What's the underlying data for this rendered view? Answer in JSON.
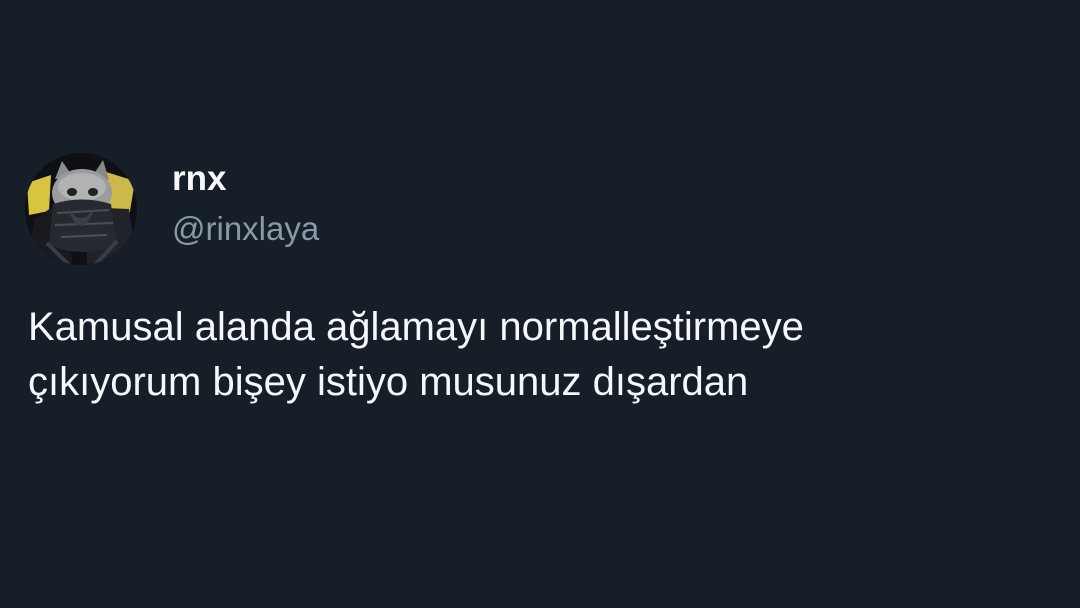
{
  "tweet": {
    "author": {
      "display_name": "rnx",
      "handle": "@rinxlaya",
      "avatar_icon": "masked-cat-avatar"
    },
    "text_lines": [
      "Kamusal alanda ağlamayı normalleştirmeye",
      "çıkıyorum bişey istiyo musunuz dışardan"
    ]
  },
  "colors": {
    "background": "#161e28",
    "primary_text": "#f5f7f9",
    "secondary_text": "#8b98a5"
  }
}
